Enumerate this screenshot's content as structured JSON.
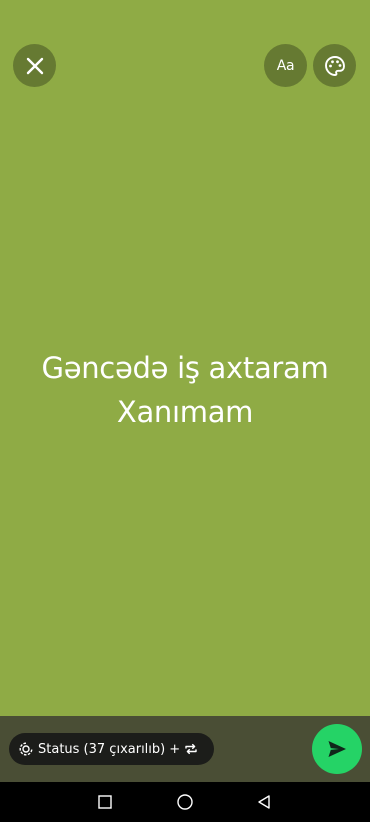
{
  "status": {
    "lines": [
      "Gəncədə iş axtaram",
      "Xanımam"
    ]
  },
  "toolbar": {
    "close_icon": "close-icon",
    "font_label": "Aa",
    "palette_icon": "palette-icon"
  },
  "privacy": {
    "label": "Status (37 çıxarılıb)",
    "plus": "+",
    "icon": "status-icon",
    "repeat_icon": "repeat-icon"
  },
  "send": {
    "icon": "send-icon"
  },
  "navbar": {
    "items": [
      "recent-apps-icon",
      "home-icon",
      "back-icon"
    ]
  },
  "colors": {
    "background": "#8fab45",
    "bottom_bar": "#4a4e35",
    "send_button": "#25d366",
    "pill": "#1c1d1a"
  }
}
